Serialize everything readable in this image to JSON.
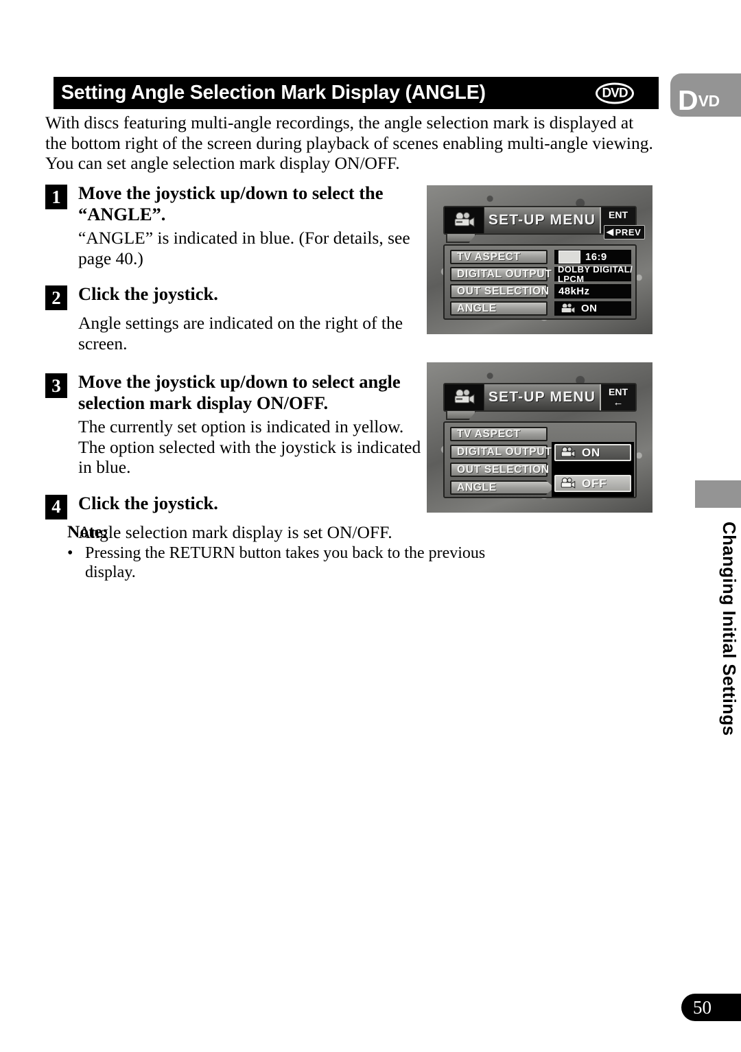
{
  "header": {
    "title": "Setting Angle Selection Mark Display (ANGLE)",
    "dvd_badge": "DVD",
    "dvd_tab_d": "D",
    "dvd_tab_vd": "VD"
  },
  "intro": "With discs featuring multi-angle recordings, the angle selection mark is displayed at the bottom right of the screen during playback of scenes enabling multi-angle viewing. You can set angle selection mark display ON/OFF.",
  "steps": [
    {
      "number": "1",
      "title": "Move the joystick up/down to select the “ANGLE”.",
      "body": "“ANGLE” is indicated in blue. (For details, see page 40.)"
    },
    {
      "number": "2",
      "title": "Click the joystick.",
      "body": "Angle settings are indicated on the right of the screen."
    },
    {
      "number": "3",
      "title": "Move the joystick up/down to select angle selection mark display ON/OFF.",
      "body": "The currently set option is indicated in yellow. The option selected with the joystick is indicated in blue."
    },
    {
      "number": "4",
      "title": "Click the joystick.",
      "body": "Angle selection mark display is set ON/OFF."
    }
  ],
  "note": {
    "title": "Note:",
    "bullet": "•",
    "items": [
      "Pressing the RETURN button takes you back to the previous display."
    ]
  },
  "screens": [
    {
      "id": "setup-menu-overview",
      "title": "SET-UP MENU",
      "ent_label": "ENT",
      "prev_label": "PREV",
      "menu_items": [
        "TV ASPECT",
        "DIGITAL OUTPUT",
        "OUT SELECTION",
        "ANGLE"
      ],
      "values": {
        "tv_aspect": "16:9",
        "digital_output_line1": "DOLBY DIGITAL/",
        "digital_output_line2": "LPCM",
        "out_selection": "48kHz",
        "angle": "ON"
      }
    },
    {
      "id": "setup-menu-angle-options",
      "title": "SET-UP MENU",
      "ent_label": "ENT",
      "menu_items": [
        "TV ASPECT",
        "DIGITAL OUTPUT",
        "OUT SELECTION",
        "ANGLE"
      ],
      "options": [
        {
          "label": "ON",
          "state": "selected"
        },
        {
          "label": "OFF",
          "state": "unselected"
        }
      ]
    }
  ],
  "side_tab": {
    "label": "Changing Initial Settings"
  },
  "footer": {
    "page_number": "50"
  },
  "colors": {
    "header_bg": "#000000",
    "header_text": "#ffffff",
    "dvd_tab_bg": "#949494",
    "body_text": "#000000",
    "page_bg": "#ffffff"
  }
}
